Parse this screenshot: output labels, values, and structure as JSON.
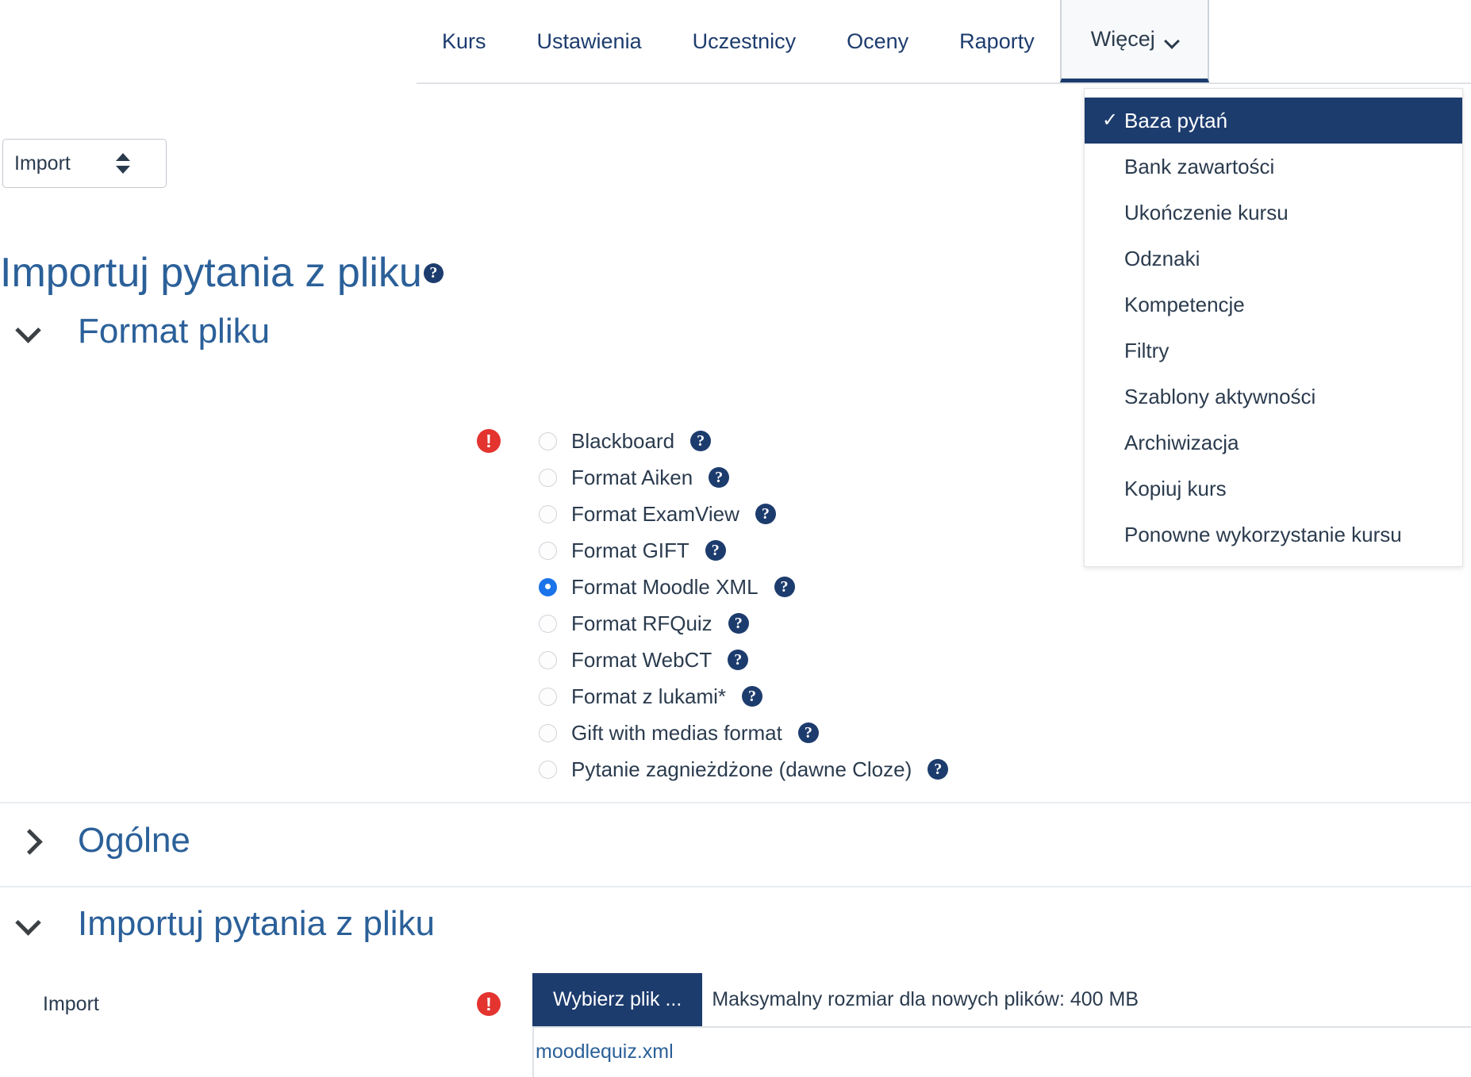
{
  "nav": {
    "items": [
      {
        "label": "Kurs",
        "active": false
      },
      {
        "label": "Ustawienia",
        "active": false
      },
      {
        "label": "Uczestnicy",
        "active": false
      },
      {
        "label": "Oceny",
        "active": false
      },
      {
        "label": "Raporty",
        "active": false
      }
    ],
    "more_label": "Więcej",
    "more_caret_icon": "chevron-down-icon"
  },
  "dropdown": {
    "items": [
      {
        "label": "Baza pytań",
        "selected": true
      },
      {
        "label": "Bank zawartości",
        "selected": false
      },
      {
        "label": "Ukończenie kursu",
        "selected": false
      },
      {
        "label": "Odznaki",
        "selected": false
      },
      {
        "label": "Kompetencje",
        "selected": false
      },
      {
        "label": "Filtry",
        "selected": false
      },
      {
        "label": "Szablony aktywności",
        "selected": false
      },
      {
        "label": "Archiwizacja",
        "selected": false
      },
      {
        "label": "Kopiuj kurs",
        "selected": false
      },
      {
        "label": "Ponowne wykorzystanie kursu",
        "selected": false
      }
    ],
    "check_icon": "check-icon"
  },
  "page": {
    "select_value": "Import",
    "select_icon": "updown-arrows-icon",
    "title": "Importuj pytania z pliku",
    "title_help_icon": "help-icon",
    "title_help_glyph": "?"
  },
  "sections": {
    "file_format": {
      "title": "Format pliku",
      "expanded": true,
      "chevron_icon": "chevron-down-icon",
      "required_icon": "required-exclamation-icon",
      "required_glyph": "!"
    },
    "general": {
      "title": "Ogólne",
      "expanded": false,
      "chevron_icon": "chevron-right-icon"
    },
    "import_from_file": {
      "title": "Importuj pytania z pliku",
      "expanded": true,
      "chevron_icon": "chevron-down-icon"
    }
  },
  "formats": [
    {
      "label": "Blackboard",
      "checked": false,
      "help_glyph": "?"
    },
    {
      "label": "Format Aiken",
      "checked": false,
      "help_glyph": "?"
    },
    {
      "label": "Format ExamView",
      "checked": false,
      "help_glyph": "?"
    },
    {
      "label": "Format GIFT",
      "checked": false,
      "help_glyph": "?"
    },
    {
      "label": "Format Moodle XML",
      "checked": true,
      "help_glyph": "?"
    },
    {
      "label": "Format RFQuiz",
      "checked": false,
      "help_glyph": "?"
    },
    {
      "label": "Format WebCT",
      "checked": false,
      "help_glyph": "?"
    },
    {
      "label": "Format z lukami*",
      "checked": false,
      "help_glyph": "?"
    },
    {
      "label": "Gift with medias format",
      "checked": false,
      "help_glyph": "?"
    },
    {
      "label": "Pytanie zagnieżdżone (dawne Cloze)",
      "checked": false,
      "help_glyph": "?"
    }
  ],
  "file_upload": {
    "row_label": "Import",
    "required_icon": "required-exclamation-icon",
    "required_glyph": "!",
    "choose_button": "Wybierz plik ...",
    "max_size_text": "Maksymalny rozmiar dla nowych plików: 400 MB",
    "file_name": "moodlequiz.xml"
  },
  "colors": {
    "brand_dark": "#1d3c6e",
    "link_blue": "#2b6099",
    "required_red": "#e3342f",
    "radio_checked": "#1a73e8",
    "divider": "#e9ecef"
  }
}
